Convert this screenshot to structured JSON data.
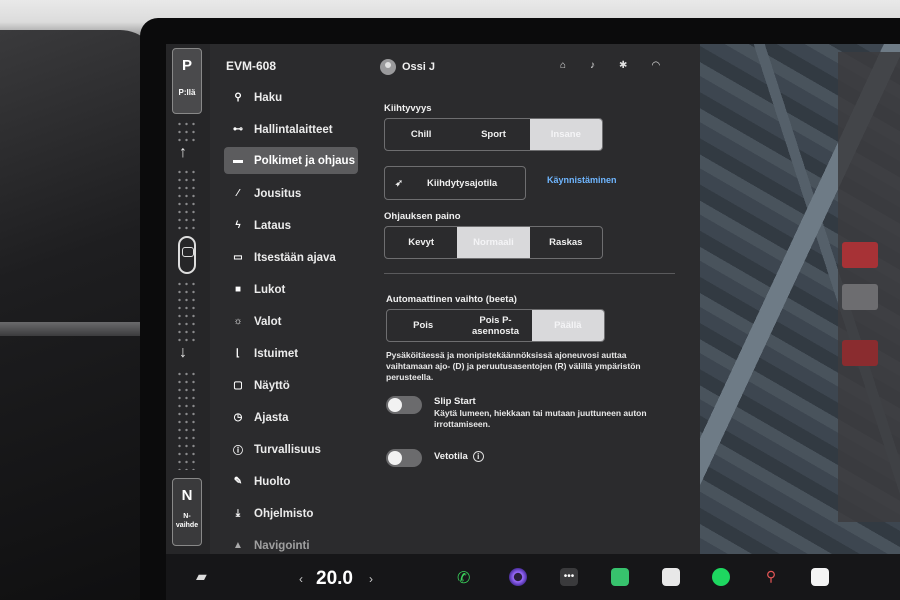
{
  "gear": {
    "top_letter": "P",
    "top_sub": "P:llä",
    "bottom_letter": "N",
    "bottom_sub": "N-\nvaihde"
  },
  "vehicle_name": "EVM-608",
  "sidebar": {
    "items": [
      {
        "label": "Haku",
        "icon": "search-icon"
      },
      {
        "label": "Hallintalaitteet",
        "icon": "toggle-icon"
      },
      {
        "label": "Polkimet ja ohjaus",
        "icon": "car-icon",
        "active": true
      },
      {
        "label": "Jousitus",
        "icon": "suspension-icon"
      },
      {
        "label": "Lataus",
        "icon": "bolt-icon"
      },
      {
        "label": "Itsestään ajava",
        "icon": "steering-icon"
      },
      {
        "label": "Lukot",
        "icon": "lock-icon"
      },
      {
        "label": "Valot",
        "icon": "sun-icon"
      },
      {
        "label": "Istuimet",
        "icon": "seat-icon"
      },
      {
        "label": "Näyttö",
        "icon": "display-icon"
      },
      {
        "label": "Ajasta",
        "icon": "alarm-icon"
      },
      {
        "label": "Turvallisuus",
        "icon": "info-icon"
      },
      {
        "label": "Huolto",
        "icon": "wrench-icon"
      },
      {
        "label": "Ohjelmisto",
        "icon": "download-icon"
      },
      {
        "label": "Navigointi",
        "icon": "navigation-icon"
      }
    ]
  },
  "header": {
    "user_name": "Ossi J"
  },
  "acceleration": {
    "label": "Kiihtyvyys",
    "options": [
      "Chill",
      "Sport",
      "Insane"
    ],
    "selected": 2
  },
  "launch": {
    "button_label": "Kiihdytysajotila",
    "link": "Käynnistäminen"
  },
  "steering": {
    "label": "Ohjauksen paino",
    "options": [
      "Kevyt",
      "Normaali",
      "Raskas"
    ],
    "selected": 1
  },
  "auto_shift": {
    "label": "Automaattinen vaihto (beeta)",
    "options": [
      "Pois",
      "Pois P-\nasennosta",
      "Päällä"
    ],
    "selected": 2,
    "description": "Pysäköitäessä ja monipistekäännöksissä ajoneuvosi auttaa vaihtamaan ajo- (D) ja peruutusasentojen (R) välillä ympäristön perusteella."
  },
  "slip_start": {
    "title": "Slip Start",
    "description": "Käytä lumeen, hiekkaan tai mutaan juuttuneen auton irrottamiseen.",
    "on": false
  },
  "towing": {
    "title": "Vetotila",
    "on": false
  },
  "taskbar": {
    "temperature": "20.0",
    "left_chevron": "‹",
    "right_chevron": "›"
  },
  "colors": {
    "accent_link": "#6fb6ff",
    "selected_segment": "#d9d9db",
    "screen_bg": "#2b2b2d"
  }
}
